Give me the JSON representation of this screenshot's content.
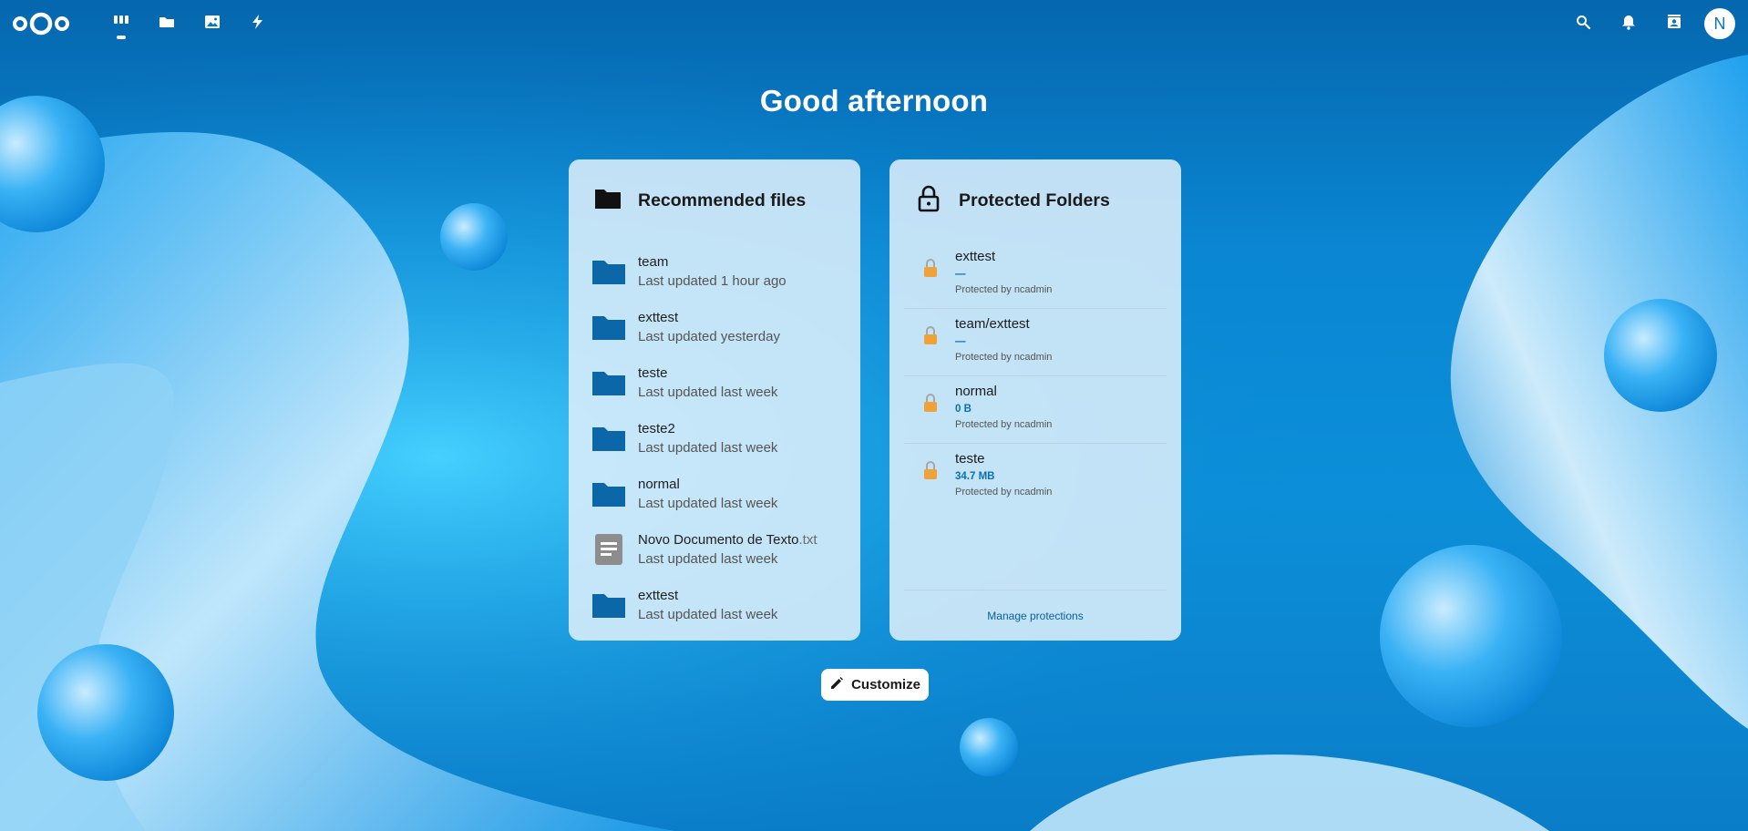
{
  "colors": {
    "accent": "#0a75bd",
    "folder": "#0b67a8",
    "lock": "#f0a23a"
  },
  "header": {
    "logo_icon": "nextcloud-logo",
    "apps": [
      {
        "icon": "dashboard-icon",
        "active": true
      },
      {
        "icon": "files-folder-icon",
        "active": false
      },
      {
        "icon": "photos-icon",
        "active": false
      },
      {
        "icon": "activity-lightning-icon",
        "active": false
      }
    ],
    "right": {
      "search_icon": "search-icon",
      "notifications_icon": "bell-icon",
      "contacts_icon": "contacts-icon",
      "avatar_initial": "N"
    }
  },
  "greeting": "Good afternoon",
  "recommended": {
    "title": "Recommended files",
    "icon": "folder-icon",
    "items": [
      {
        "name": "team",
        "ext": "",
        "subtitle": "Last updated 1 hour ago",
        "type": "folder"
      },
      {
        "name": "exttest",
        "ext": "",
        "subtitle": "Last updated yesterday",
        "type": "folder"
      },
      {
        "name": "teste",
        "ext": "",
        "subtitle": "Last updated last week",
        "type": "folder"
      },
      {
        "name": "teste2",
        "ext": "",
        "subtitle": "Last updated last week",
        "type": "folder"
      },
      {
        "name": "normal",
        "ext": "",
        "subtitle": "Last updated last week",
        "type": "folder"
      },
      {
        "name": "Novo Documento de Texto",
        "ext": ".txt",
        "subtitle": "Last updated last week",
        "type": "text"
      },
      {
        "name": "exttest",
        "ext": "",
        "subtitle": "Last updated last week",
        "type": "folder"
      }
    ]
  },
  "protected": {
    "title": "Protected Folders",
    "icon": "padlock-icon",
    "items": [
      {
        "name": "exttest",
        "size": "—",
        "by": "Protected by ncadmin"
      },
      {
        "name": "team/exttest",
        "size": "—",
        "by": "Protected by ncadmin"
      },
      {
        "name": "normal",
        "size": "0 B",
        "by": "Protected by ncadmin"
      },
      {
        "name": "teste",
        "size": "34.7 MB",
        "by": "Protected by ncadmin"
      }
    ],
    "manage_label": "Manage protections"
  },
  "customize_label": "Customize"
}
